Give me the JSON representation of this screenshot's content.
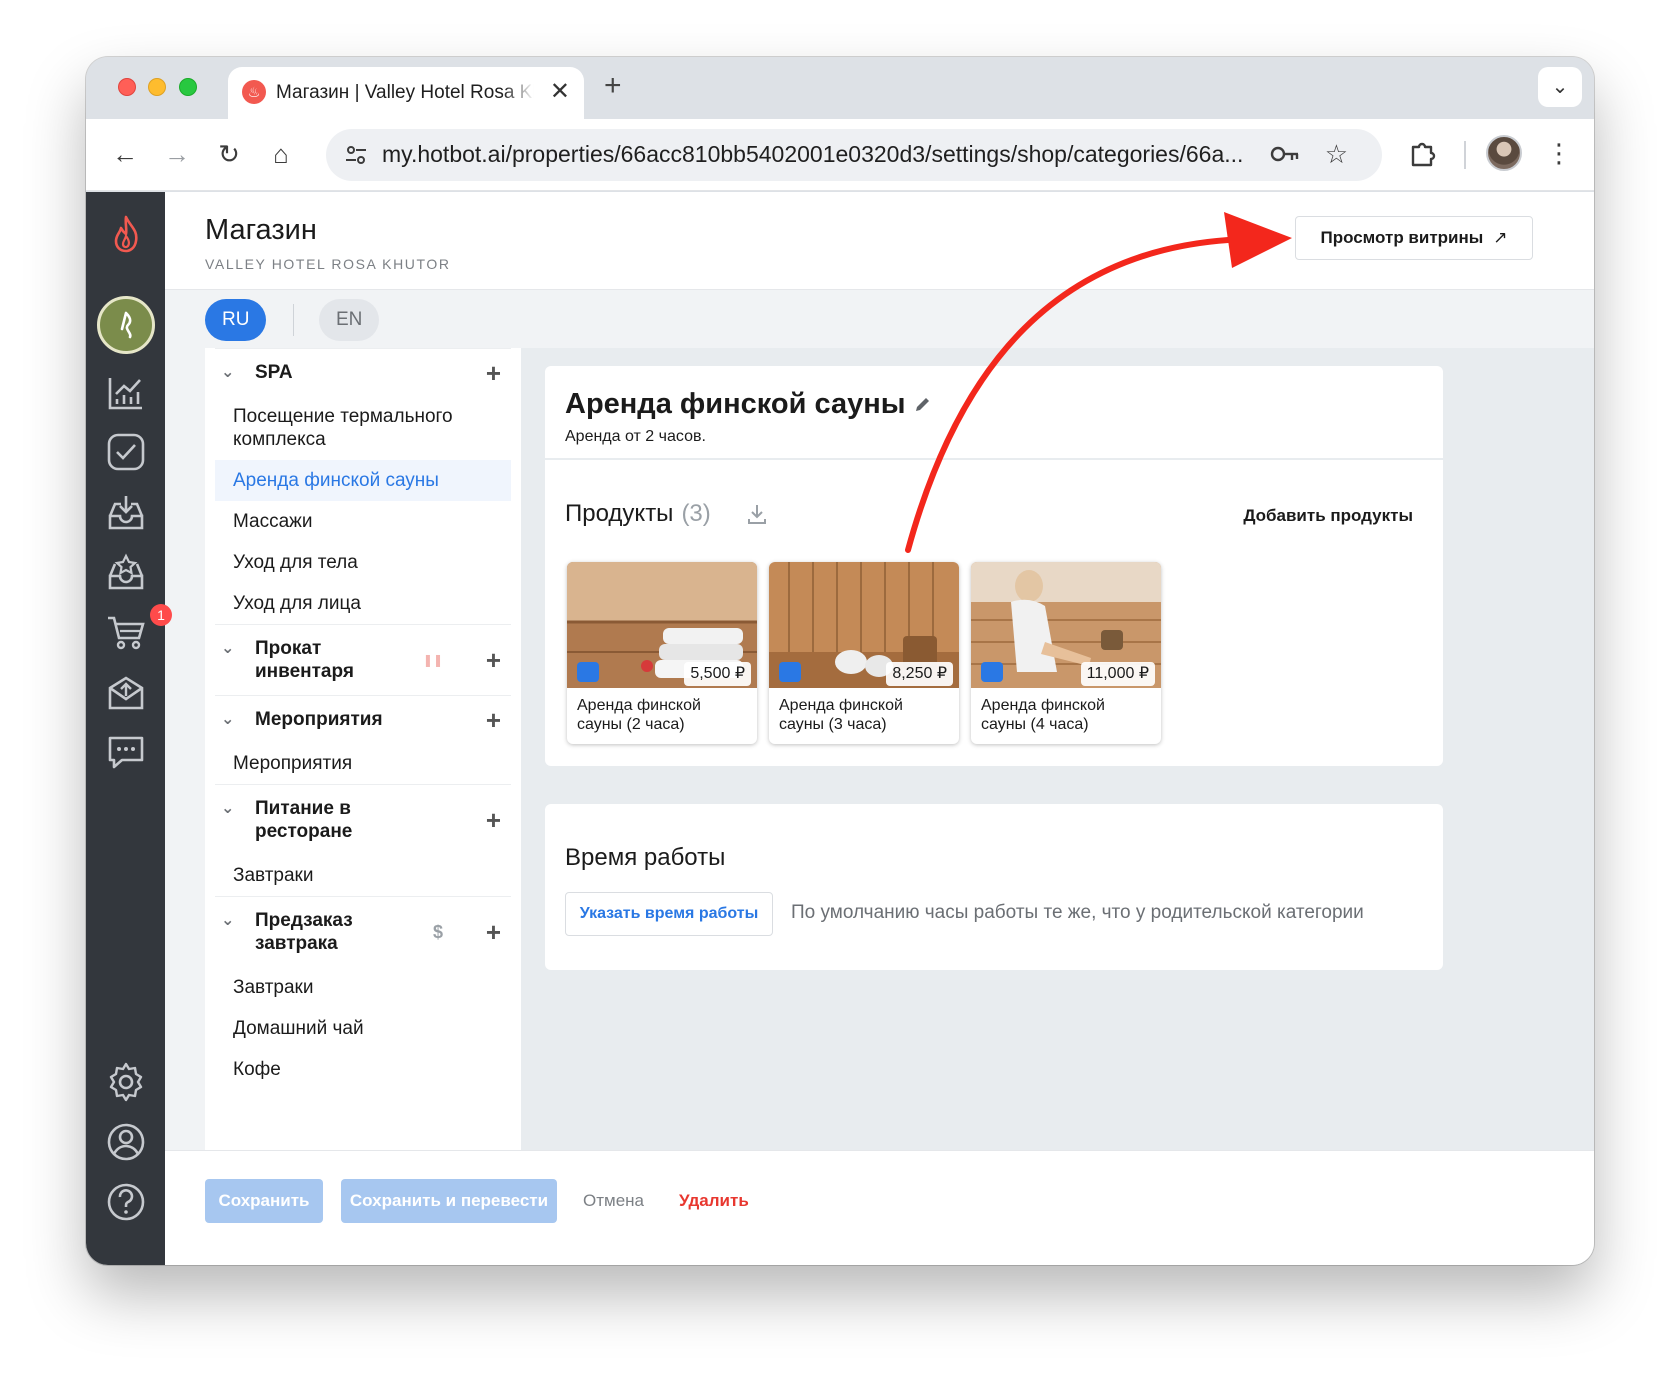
{
  "browser": {
    "tab_title": "Магазин | Valley Hotel Rosa Khutor",
    "favicon_glyph": "♨",
    "url": "my.hotbot.ai/properties/66acc810bb5402001e0320d3/settings/shop/categories/66a...",
    "close_glyph": "✕",
    "newtab_glyph": "+",
    "back_glyph": "←",
    "forward_glyph": "→",
    "reload_glyph": "↻",
    "home_glyph": "⌂",
    "star_glyph": "☆",
    "kebab_glyph": "⋮",
    "tabs_menu_glyph": "⌄"
  },
  "header": {
    "title": "Магазин",
    "subtitle": "VALLEY HOTEL ROSA KHUTOR",
    "storefront_label": "Просмотр витрины",
    "storefront_arrow": "↗"
  },
  "languages": [
    "RU",
    "EN"
  ],
  "categories": [
    {
      "title": "SPA",
      "extra": "",
      "items": [
        "Посещение термального комплекса",
        "Аренда финской сауны",
        "Массажи",
        "Уход для тела",
        "Уход для лица"
      ],
      "active": 1
    },
    {
      "title": "Прокат инвентаря",
      "extra": "pause-icon",
      "items": [],
      "active": -1
    },
    {
      "title": "Мероприятия",
      "extra": "",
      "items": [
        "Мероприятия"
      ],
      "active": -1
    },
    {
      "title": "Питание в ресторане",
      "extra": "",
      "items": [
        "Завтраки"
      ],
      "active": -1
    },
    {
      "title": "Предзаказ завтрака",
      "extra": "dollar-icon",
      "items": [
        "Завтраки",
        "Домашний чай",
        "Кофе"
      ],
      "active": -1
    }
  ],
  "category_extra_glyphs": {
    "pause": "❚❚",
    "dollar": "$"
  },
  "plus_glyph": "+",
  "chevron_glyph": "⌄",
  "category": {
    "title": "Аренда финской сауны",
    "description": "Аренда от 2 часов."
  },
  "products": {
    "title": "Продукты",
    "count": "(3)",
    "add_label": "Добавить продукты",
    "items": [
      {
        "name": "Аренда финской сауны (2 часа)",
        "price": "5,500 ₽"
      },
      {
        "name": "Аренда финской сауны (3 часа)",
        "price": "8,250 ₽"
      },
      {
        "name": "Аренда финской сауны (4 часа)",
        "price": "11,000 ₽"
      }
    ]
  },
  "hours": {
    "title": "Время работы",
    "button_label": "Указать время работы",
    "note": "По умолчанию часы работы те же, что у родительской категории"
  },
  "footer": {
    "save": "Сохранить",
    "save_translate": "Сохранить и перевести",
    "cancel": "Отмена",
    "delete": "Удалить"
  },
  "rail": {
    "cart_badge": "1"
  },
  "colors": {
    "accent": "#2a78e4",
    "danger": "#e8372f",
    "rail": "#33373d",
    "annotation_arrow": "#f3271c"
  }
}
